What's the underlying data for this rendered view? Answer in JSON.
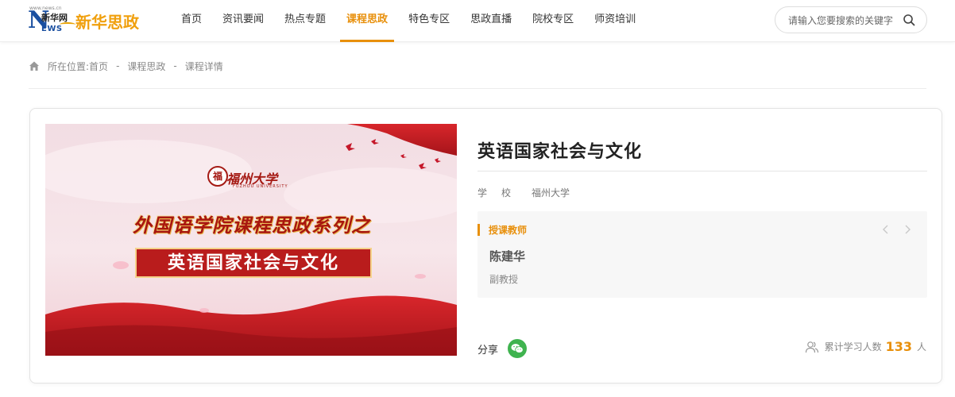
{
  "header": {
    "logo": {
      "news_mark": "NEWS",
      "news_cn": "新华网",
      "news_url": "www.news.cn",
      "brand_text": "新华思政"
    },
    "nav": [
      {
        "label": "首页",
        "active": false
      },
      {
        "label": "资讯要闻",
        "active": false
      },
      {
        "label": "热点专题",
        "active": false
      },
      {
        "label": "课程思政",
        "active": true
      },
      {
        "label": "特色专区",
        "active": false
      },
      {
        "label": "思政直播",
        "active": false
      },
      {
        "label": "院校专区",
        "active": false
      },
      {
        "label": "师资培训",
        "active": false
      }
    ],
    "search": {
      "placeholder": "请输入您要搜索的关键字",
      "value": ""
    }
  },
  "breadcrumb": {
    "prefix": "所在位置:",
    "items": [
      "首页",
      "课程思政",
      "课程详情"
    ],
    "separator": "-"
  },
  "course": {
    "cover": {
      "university_cn": "福州大学",
      "university_en": "FUZHOU UNIVERSITY",
      "seal_char": "福",
      "series_title": "外国语学院课程思政系列之",
      "course_title": "英语国家社会与文化"
    },
    "title": "英语国家社会与文化",
    "school_label": "学校",
    "school_value": "福州大学",
    "teacher": {
      "section_label": "授课教师",
      "name": "陈建华",
      "rank": "副教授"
    },
    "share_label": "分享",
    "learners": {
      "label": "累计学习人数",
      "count": "133",
      "unit": "人"
    }
  },
  "colors": {
    "accent": "#e8900c",
    "wechat": "#3fb34f",
    "cover_red": "#b91c1c"
  }
}
